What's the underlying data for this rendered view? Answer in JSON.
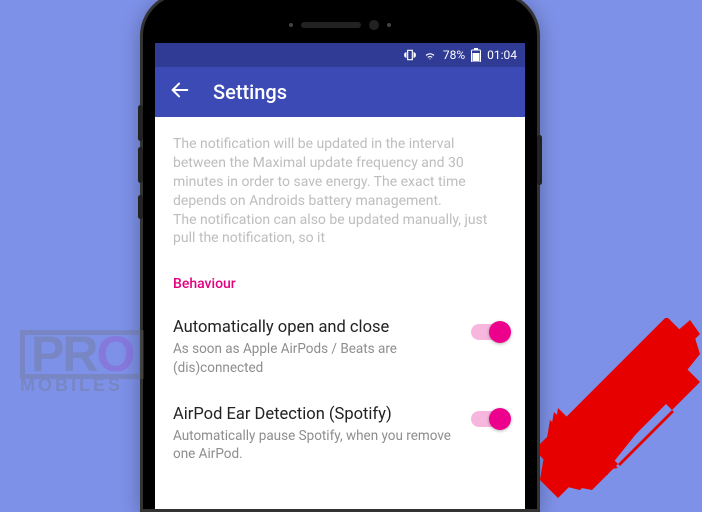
{
  "statusbar": {
    "battery_pct": "78%",
    "time": "01:04"
  },
  "appbar": {
    "title": "Settings"
  },
  "info_text": "The notification will be updated in the interval between the Maximal update frequency and 30 minutes in order to save energy. The exact time depends on Androids battery management.\nThe notification can also be updated manually, just pull the notification, so it",
  "section": {
    "header": "Behaviour",
    "items": [
      {
        "title": "Automatically open and close",
        "subtitle": "As soon as Apple AirPods / Beats are (dis)connected",
        "on": true
      },
      {
        "title": "AirPod Ear Detection (Spotify)",
        "subtitle": "Automatically pause Spotify, when you remove one AirPod.",
        "on": true
      }
    ]
  },
  "watermark": {
    "line1a": "PR",
    "line1b": "O",
    "line2": "MOBILES"
  }
}
